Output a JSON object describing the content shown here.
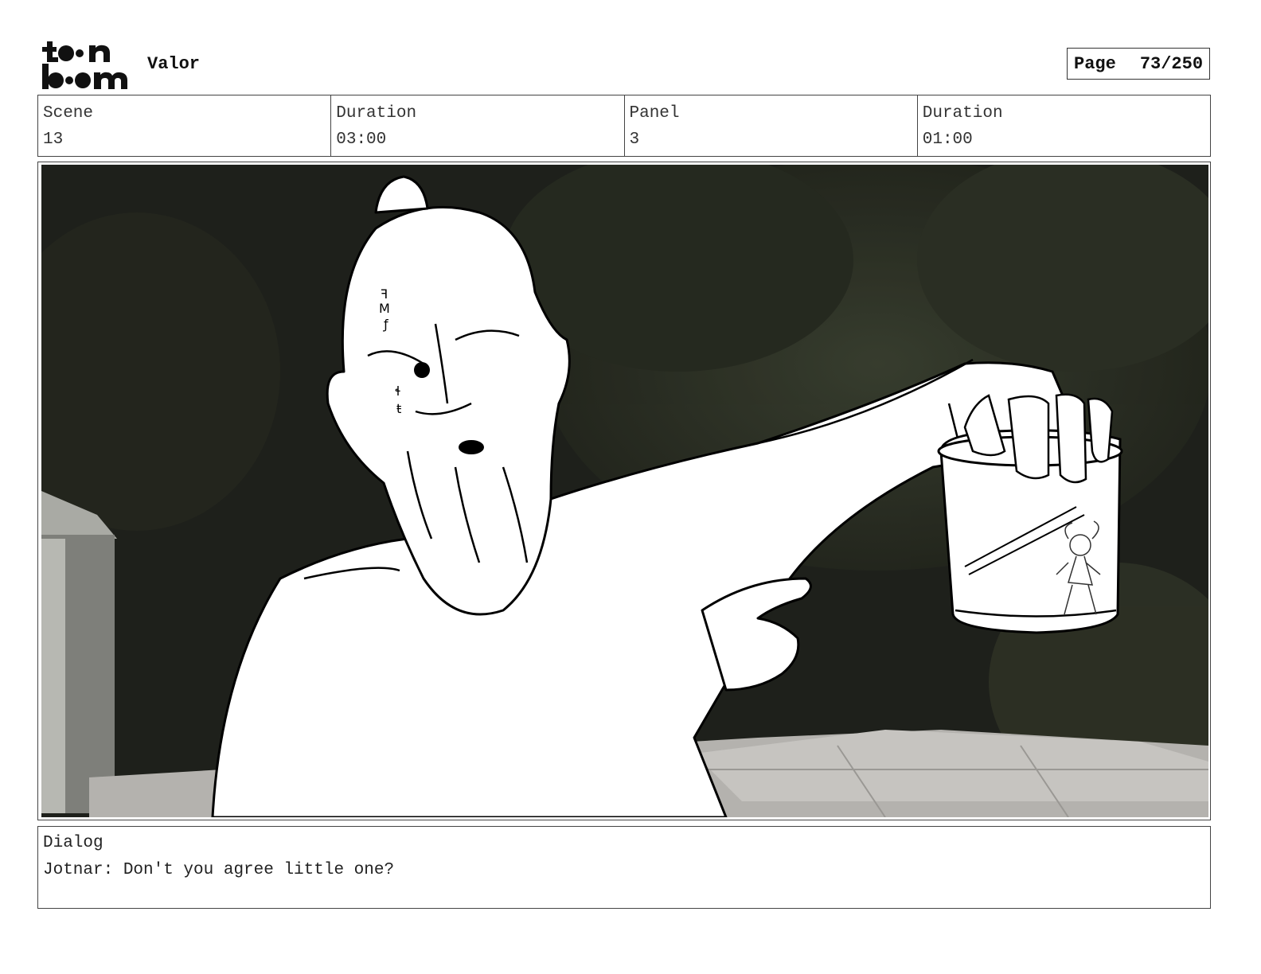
{
  "header": {
    "logo_text": "toon boom",
    "project_title": "Valor",
    "page_label": "Page",
    "page_number": "73/250"
  },
  "info": {
    "scene_label": "Scene",
    "scene_value": "13",
    "scene_duration_label": "Duration",
    "scene_duration_value": "03:00",
    "panel_label": "Panel",
    "panel_value": "3",
    "panel_duration_label": "Duration",
    "panel_duration_value": "01:00"
  },
  "dialog": {
    "label": "Dialog",
    "text": "Jotnar: Don't you agree little one?"
  },
  "colors": {
    "foliage": "#2a2e22",
    "sky": "#1c1d1a",
    "roof": "#b8b6b2",
    "line": "#000000"
  }
}
